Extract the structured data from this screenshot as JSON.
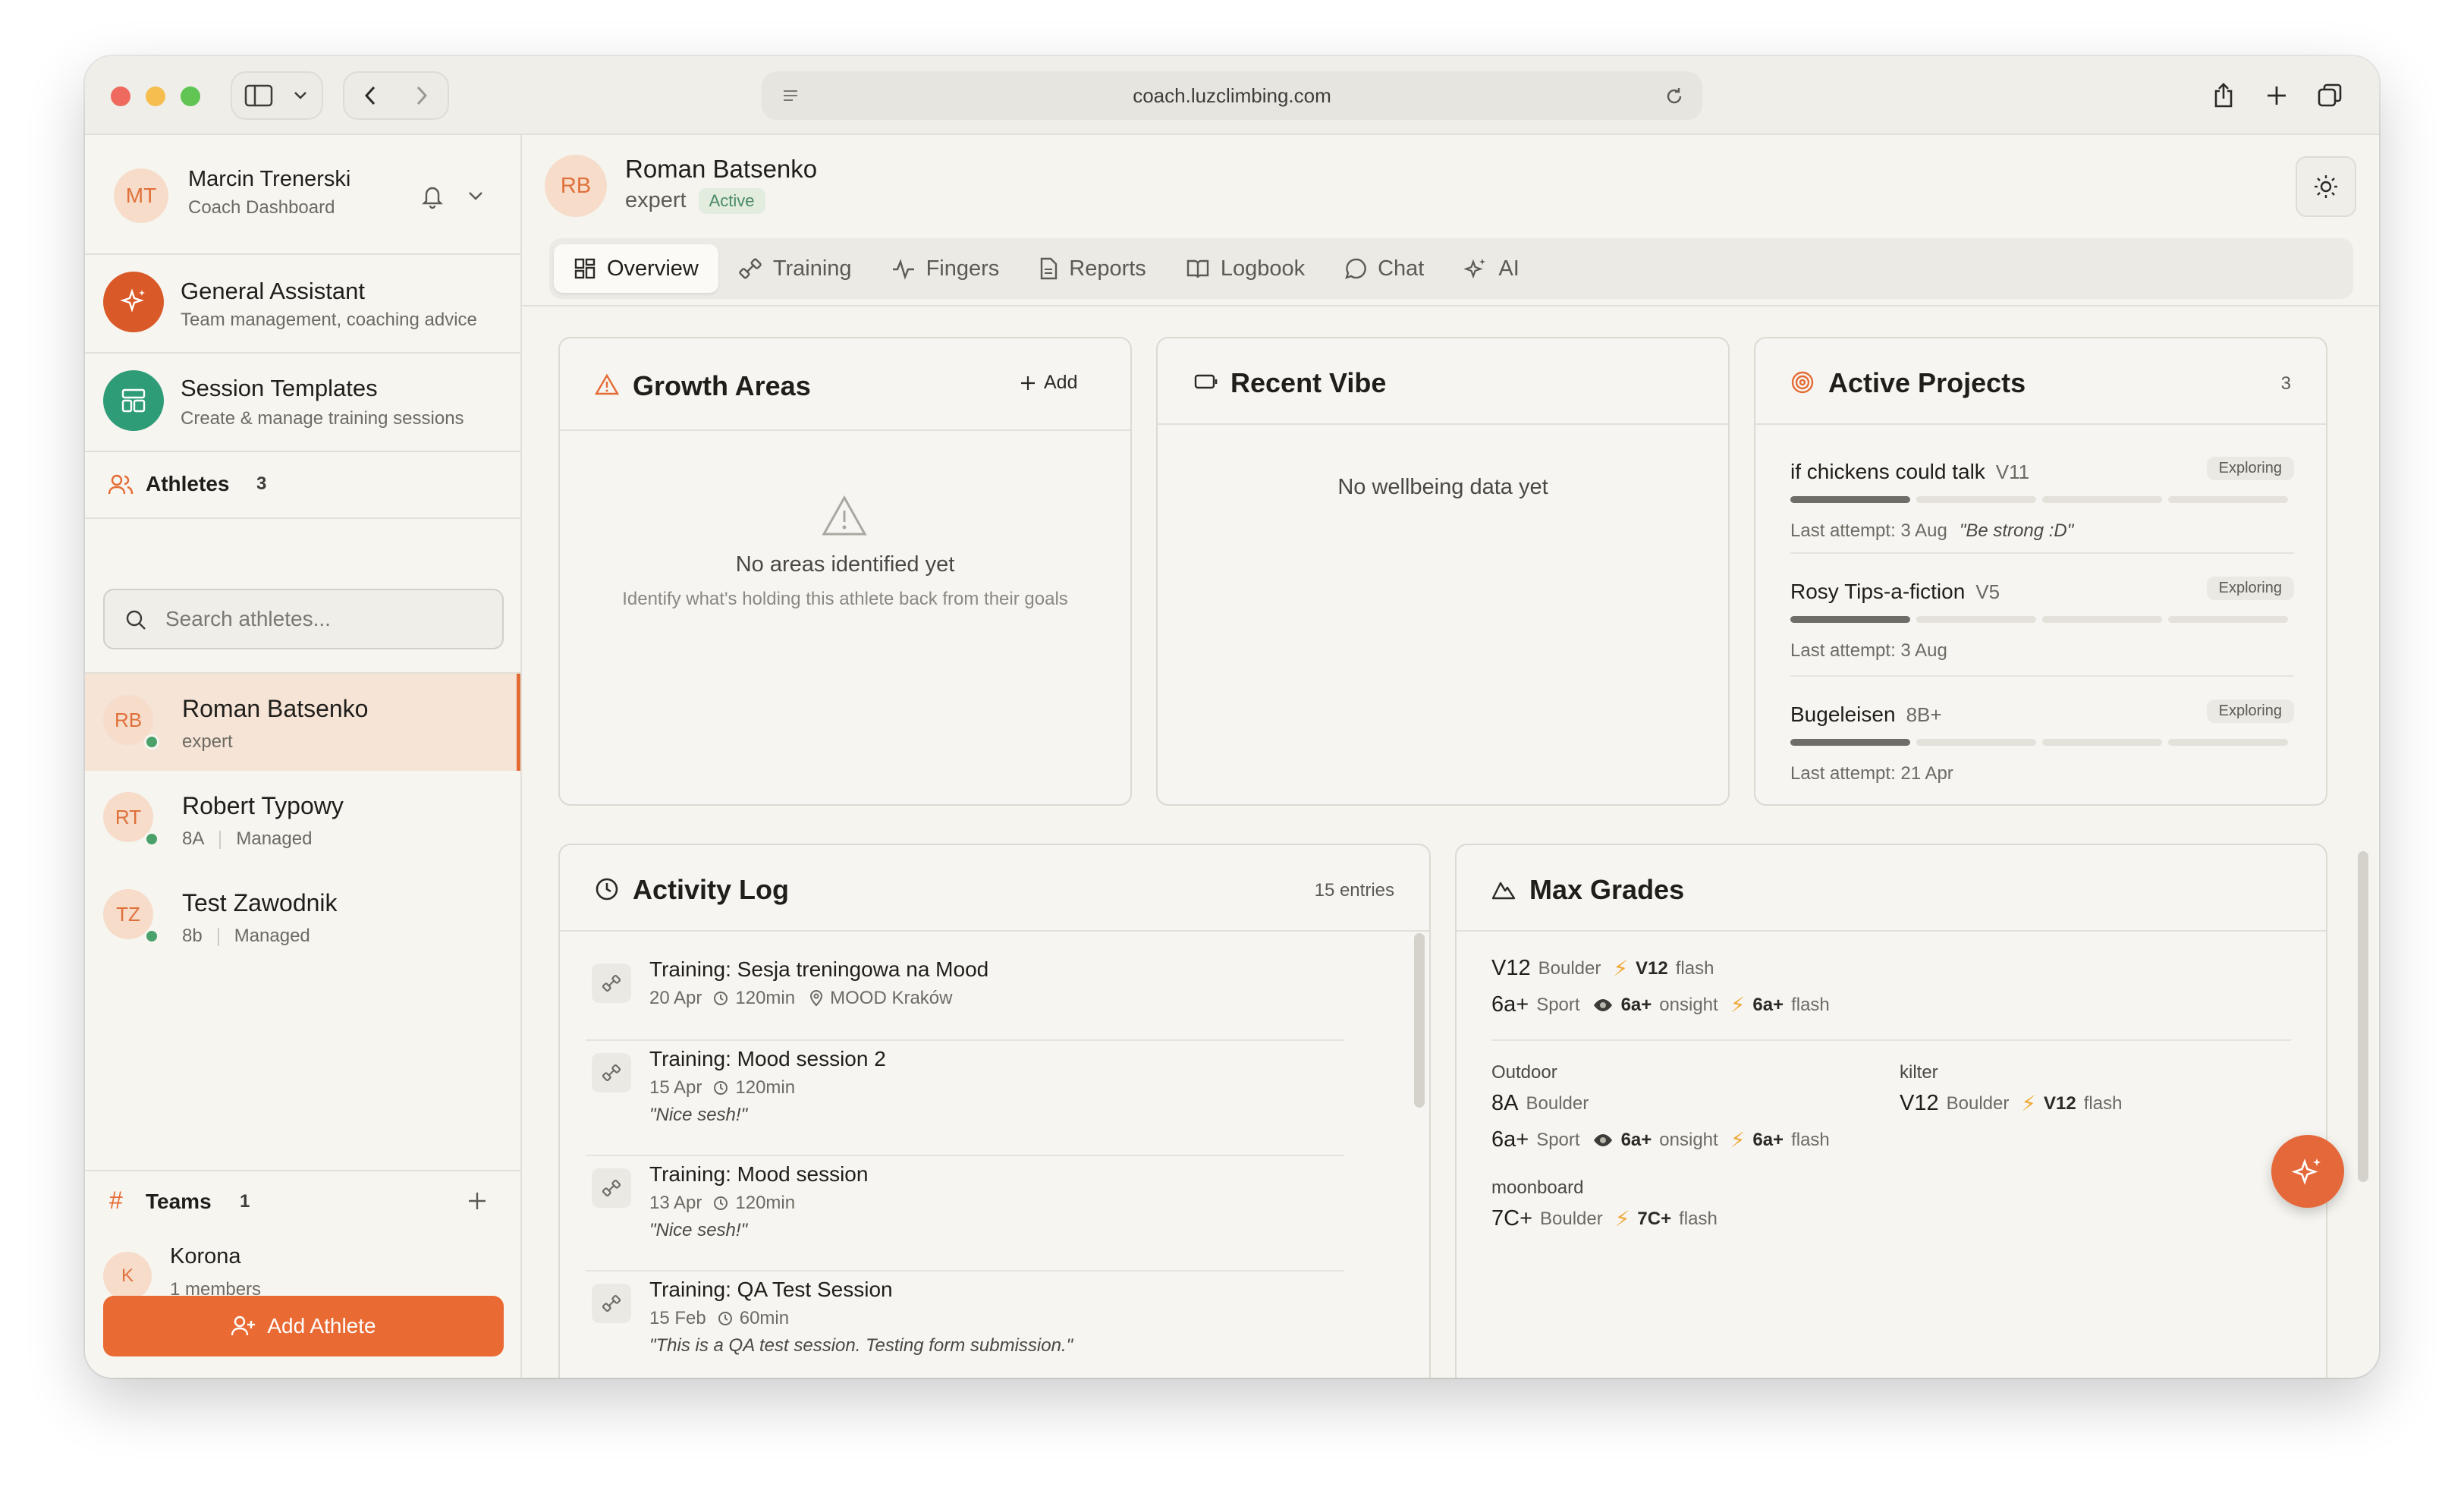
{
  "browser": {
    "url": "coach.luzclimbing.com"
  },
  "sidebar": {
    "user": {
      "initials": "MT",
      "name": "Marcin Trenerski",
      "role": "Coach Dashboard"
    },
    "features": [
      {
        "title": "General Assistant",
        "subtitle": "Team management, coaching advice"
      },
      {
        "title": "Session Templates",
        "subtitle": "Create & manage training sessions"
      }
    ],
    "athletes_label": "Athletes",
    "athletes_count": "3",
    "search_placeholder": "Search athletes...",
    "athletes": [
      {
        "initials": "RB",
        "name": "Roman Batsenko",
        "level": "expert",
        "tag": ""
      },
      {
        "initials": "RT",
        "name": "Robert Typowy",
        "level": "8A",
        "tag": "Managed"
      },
      {
        "initials": "TZ",
        "name": "Test Zawodnik",
        "level": "8b",
        "tag": "Managed"
      }
    ],
    "teams_label": "Teams",
    "teams_count": "1",
    "teams": [
      {
        "initial": "K",
        "name": "Korona",
        "members": "1 members"
      }
    ],
    "add_athlete_label": "Add Athlete"
  },
  "header": {
    "initials": "RB",
    "name": "Roman Batsenko",
    "level": "expert",
    "status": "Active"
  },
  "tabs": [
    {
      "label": "Overview",
      "icon": "grid-icon"
    },
    {
      "label": "Training",
      "icon": "dumbbell-icon"
    },
    {
      "label": "Fingers",
      "icon": "pulse-icon"
    },
    {
      "label": "Reports",
      "icon": "file-icon"
    },
    {
      "label": "Logbook",
      "icon": "book-icon"
    },
    {
      "label": "Chat",
      "icon": "chat-icon"
    },
    {
      "label": "AI",
      "icon": "sparkles-icon"
    }
  ],
  "growth": {
    "title": "Growth Areas",
    "add_label": "Add",
    "empty_title": "No areas identified yet",
    "empty_sub": "Identify what's holding this athlete back from their goals"
  },
  "vibe": {
    "title": "Recent Vibe",
    "empty": "No wellbeing data yet"
  },
  "projects": {
    "title": "Active Projects",
    "count": "3",
    "items": [
      {
        "name": "if chickens could talk",
        "grade": "V11",
        "status": "Exploring",
        "progress_steps": 1,
        "last": "Last attempt: 3 Aug",
        "note": "\"Be strong :D\""
      },
      {
        "name": "Rosy Tips-a-fiction",
        "grade": "V5",
        "status": "Exploring",
        "progress_steps": 1,
        "last": "Last attempt: 3 Aug",
        "note": ""
      },
      {
        "name": "Bugeleisen",
        "grade": "8B+",
        "status": "Exploring",
        "progress_steps": 1,
        "last": "Last attempt: 21 Apr",
        "note": ""
      }
    ]
  },
  "activity": {
    "title": "Activity Log",
    "count": "15 entries",
    "items": [
      {
        "title": "Training: Sesja treningowa na Mood",
        "date": "20 Apr",
        "duration": "120min",
        "location": "MOOD Kraków",
        "quote": ""
      },
      {
        "title": "Training: Mood session 2",
        "date": "15 Apr",
        "duration": "120min",
        "location": "",
        "quote": "\"Nice sesh!\""
      },
      {
        "title": "Training: Mood session",
        "date": "13 Apr",
        "duration": "120min",
        "location": "",
        "quote": "\"Nice sesh!\""
      },
      {
        "title": "Training: QA Test Session",
        "date": "15 Feb",
        "duration": "60min",
        "location": "",
        "quote": "\"This is a QA test session. Testing form submission.\""
      }
    ]
  },
  "grades": {
    "title": "Max Grades",
    "summary": [
      {
        "grade": "V12",
        "type": "Boulder",
        "a_grade": "",
        "a_label": "",
        "flash_grade": "V12",
        "flash_label": "flash"
      },
      {
        "grade": "6a+",
        "type": "Sport",
        "a_grade": "6a+",
        "a_label": "onsight",
        "flash_grade": "6a+",
        "flash_label": "flash"
      }
    ],
    "outdoor": {
      "label": "Outdoor",
      "rows": [
        {
          "grade": "8A",
          "type": "Boulder",
          "a_grade": "",
          "a_label": "",
          "flash_grade": "",
          "flash_label": ""
        },
        {
          "grade": "6a+",
          "type": "Sport",
          "a_grade": "6a+",
          "a_label": "onsight",
          "flash_grade": "6a+",
          "flash_label": "flash"
        }
      ]
    },
    "kilter": {
      "label": "kilter",
      "rows": [
        {
          "grade": "V12",
          "type": "Boulder",
          "flash_grade": "V12",
          "flash_label": "flash"
        }
      ]
    },
    "moonboard": {
      "label": "moonboard",
      "rows": [
        {
          "grade": "7C+",
          "type": "Boulder",
          "flash_grade": "7C+",
          "flash_label": "flash"
        }
      ]
    }
  },
  "colors": {
    "accent": "#ea6a33",
    "active": "#4aa16a",
    "teal": "#2f9c78"
  }
}
